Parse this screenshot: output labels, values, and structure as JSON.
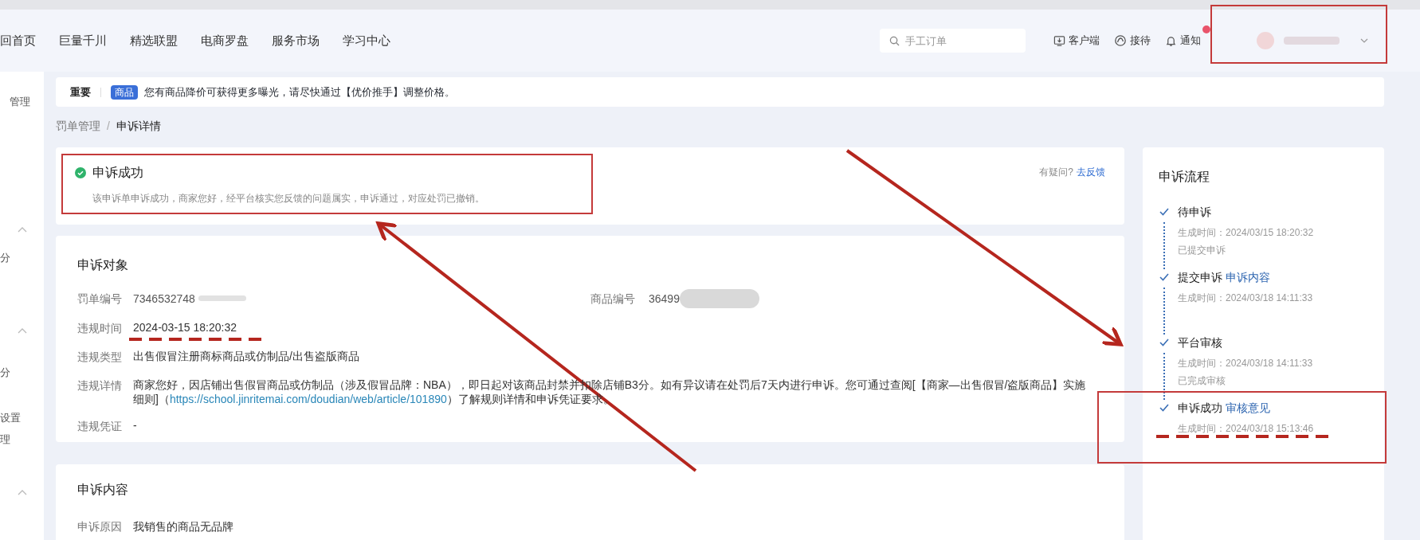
{
  "nav": {
    "items": [
      "回首页",
      "巨量千川",
      "精选联盟",
      "电商罗盘",
      "服务市场",
      "学习中心"
    ],
    "search": {
      "placeholder": "手工订单"
    },
    "actions": [
      {
        "kind": "download",
        "label": "客户端"
      },
      {
        "kind": "service",
        "label": "接待"
      },
      {
        "kind": "bell",
        "label": "通知",
        "badge": true
      }
    ]
  },
  "sidebar": {
    "items": [
      {
        "label": "管理"
      },
      {
        "label": "分"
      },
      {
        "label": "分"
      },
      {
        "label": "设置"
      },
      {
        "label": "理"
      }
    ]
  },
  "notice": {
    "level": "重要",
    "tag": "商品",
    "text": "您有商品降价可获得更多曝光，请尽快通过【优价推手】调整价格。"
  },
  "breadcrumb": {
    "separator": "/",
    "items": [
      "罚单管理",
      "申诉详情"
    ]
  },
  "status": {
    "title": "申诉成功",
    "description": "该申诉单申诉成功，商家您好，经平台核实您反馈的问题属实，申诉通过，对应处罚已撤销。",
    "help": "有疑问?",
    "help_link": "去反馈"
  },
  "appeal_object": {
    "title": "申诉对象",
    "penalty_no": {
      "label": "罚单编号",
      "value": "7346532748"
    },
    "product_no": {
      "label": "商品编号",
      "value": "36499"
    },
    "rows": [
      {
        "label": "违规时间",
        "value": "2024-03-15 18:20:32"
      },
      {
        "label": "违规类型",
        "value": "出售假冒注册商标商品或仿制品/出售盗版商品"
      },
      {
        "label": "违规详情",
        "value": "商家您好，因店铺出售假冒商品或仿制品（涉及假冒品牌：NBA），即日起对该商品封禁并扣除店铺B3分。如有异议请在处罚后7天内进行申诉。您可通过查阅[【商家—出售假冒/盗版商品】实施细则]（",
        "link": "https://school.jinritemai.com/doudian/web/article/101890",
        "value_after": "）了解规则详情和申诉凭证要求。"
      },
      {
        "label": "违规凭证",
        "value": "-"
      }
    ]
  },
  "appeal_content": {
    "title": "申诉内容",
    "rows": [
      {
        "label": "申诉原因",
        "value": "我销售的商品无品牌"
      }
    ]
  },
  "flow": {
    "title": "申诉流程",
    "steps": [
      {
        "title": "待申诉",
        "time": "生成时间：2024/03/15 18:20:32",
        "note": "已提交申诉",
        "done": true
      },
      {
        "title": "提交申诉",
        "link": "申诉内容",
        "time": "生成时间：2024/03/18 14:11:33",
        "done": true
      },
      {
        "title": "平台审核",
        "time": "生成时间：2024/03/18 14:11:33",
        "note": "已完成审核",
        "done": true
      },
      {
        "title": "申诉成功",
        "link": "审核意见",
        "time": "生成时间：2024/03/18 15:13:46",
        "done": true
      }
    ]
  }
}
